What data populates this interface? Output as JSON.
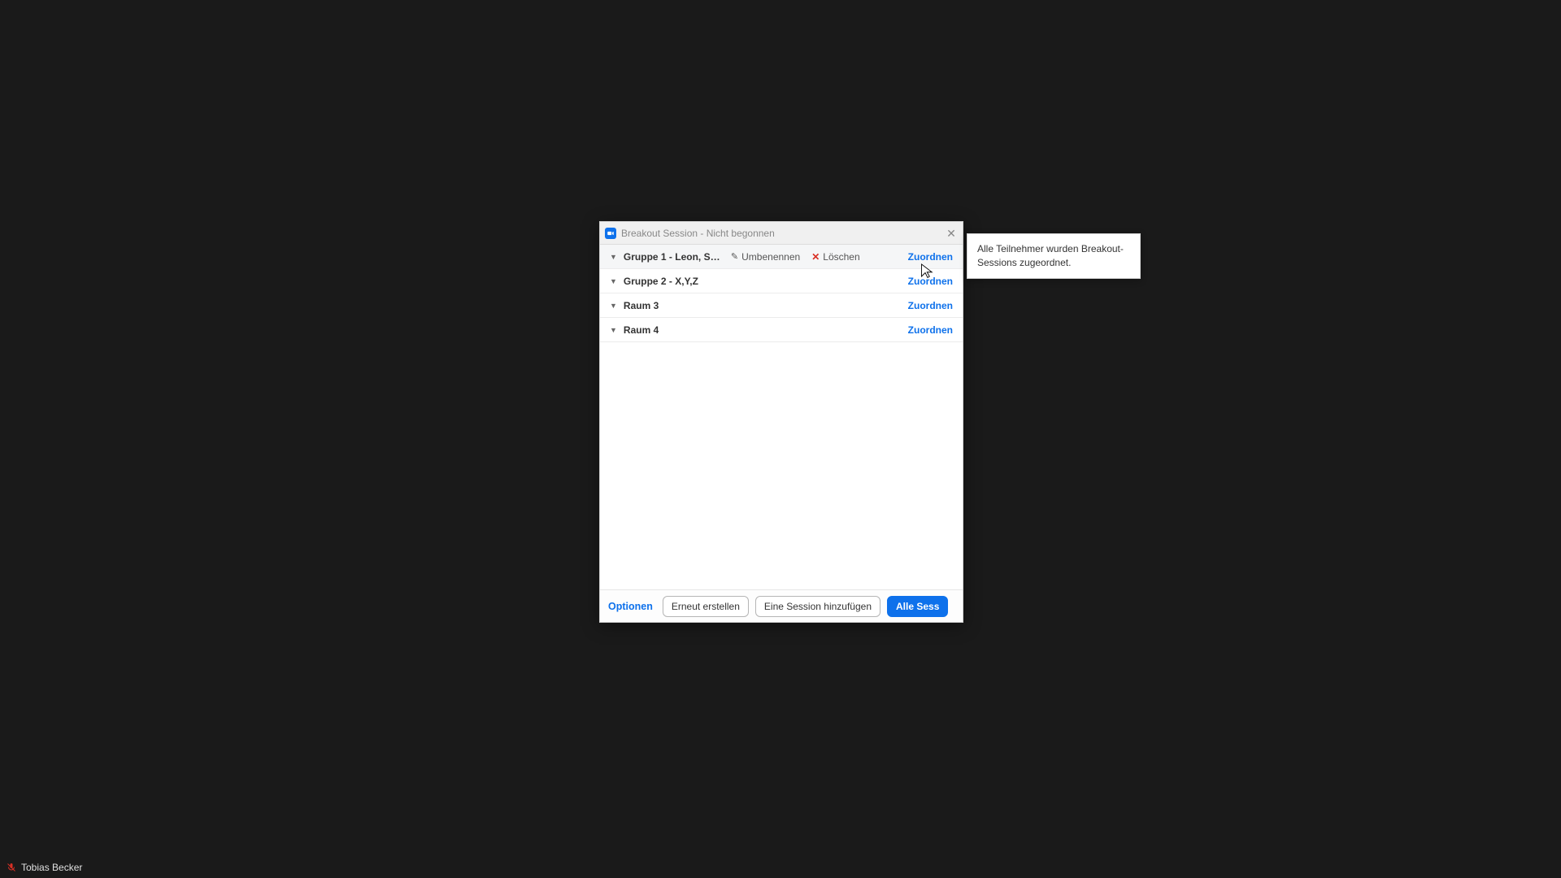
{
  "dialog": {
    "title": "Breakout Session - Nicht begonnen",
    "assign_label": "Zuordnen",
    "rename_label": "Umbenennen",
    "delete_label": "Löschen",
    "rooms": [
      {
        "name": "Gruppe 1 - Leon, Sa...",
        "hovered": true
      },
      {
        "name": "Gruppe 2 - X,Y,Z",
        "hovered": false
      },
      {
        "name": "Raum 3",
        "hovered": false
      },
      {
        "name": "Raum 4",
        "hovered": false
      }
    ]
  },
  "footer": {
    "options": "Optionen",
    "recreate": "Erneut erstellen",
    "add_session": "Eine Session hinzufügen",
    "start_all": "Alle Sess"
  },
  "tooltip": {
    "text": "Alle Teilnehmer wurden Breakout-Sessions zugeordnet."
  },
  "user": {
    "name": "Tobias Becker"
  }
}
